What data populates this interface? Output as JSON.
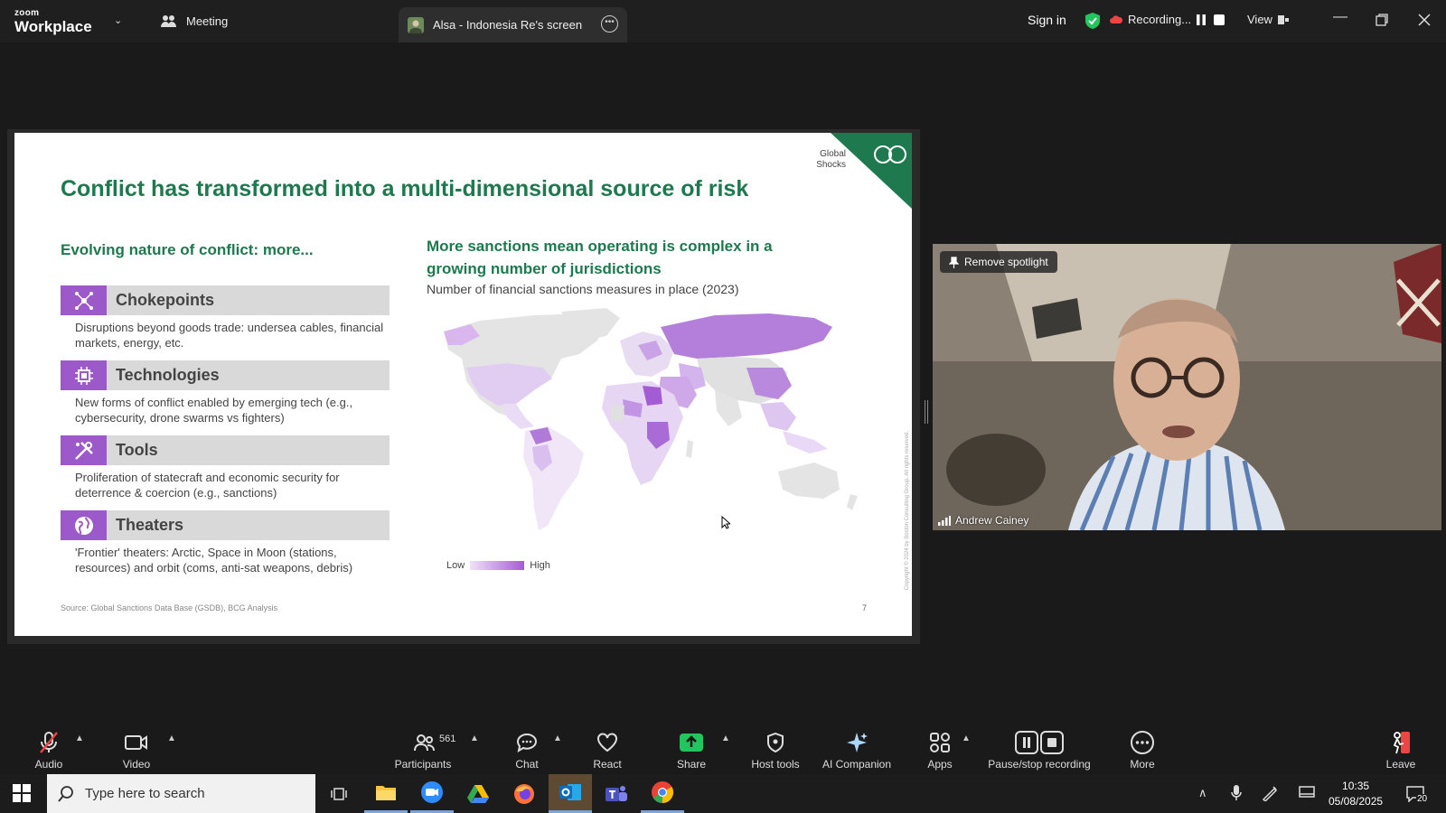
{
  "titlebar": {
    "logo_top": "zoom",
    "logo_bottom": "Workplace",
    "meeting_tab": "Meeting",
    "screen_tab": "Alsa - Indonesia Re's screen",
    "sign_in": "Sign in",
    "recording": "Recording...",
    "view": "View"
  },
  "slide": {
    "title": "Conflict has transformed into a multi-dimensional source of risk",
    "corner_label_1": "Global",
    "corner_label_2": "Shocks",
    "left_heading": "Evolving nature of conflict: more...",
    "items": [
      {
        "label": "Chokepoints",
        "desc": "Disruptions beyond goods trade: undersea cables, financial markets, energy, etc."
      },
      {
        "label": "Technologies",
        "desc": "New forms of conflict enabled by emerging tech     (e.g., cybersecurity, drone swarms vs fighters)"
      },
      {
        "label": "Tools",
        "desc": "Proliferation of statecraft and economic security      for deterrence & coercion (e.g., sanctions)"
      },
      {
        "label": "Theaters",
        "desc": "'Frontier' theaters: Arctic, Space in Moon (stations, resources) and orbit (coms, anti-sat weapons, debris)"
      }
    ],
    "right_heading": "More sanctions mean operating is complex in a growing number of jurisdictions",
    "right_sub": "Number of financial sanctions measures in place (2023)",
    "legend_low": "Low",
    "legend_high": "High",
    "source": "Source: Global Sanctions Data Base (GSDB), BCG Analysis",
    "page_number": "7",
    "copyright": "Copyright © 2024 by Boston Consulting Group. All rights reserved."
  },
  "video": {
    "spotlight_button": "Remove spotlight",
    "participant_name": "Andrew Cainey"
  },
  "toolbar": {
    "audio": "Audio",
    "video": "Video",
    "participants": "Participants",
    "participants_count": "561",
    "chat": "Chat",
    "react": "React",
    "share": "Share",
    "host_tools": "Host tools",
    "ai_companion": "AI Companion",
    "apps": "Apps",
    "pause_stop": "Pause/stop recording",
    "more": "More",
    "leave": "Leave"
  },
  "taskbar": {
    "search_placeholder": "Type here to search",
    "time": "10:35",
    "date": "05/08/2025",
    "notifications": "20"
  },
  "colors": {
    "slide_green": "#1e7a4e",
    "icon_purple": "#9b59c9",
    "share_green": "#22c55e"
  }
}
